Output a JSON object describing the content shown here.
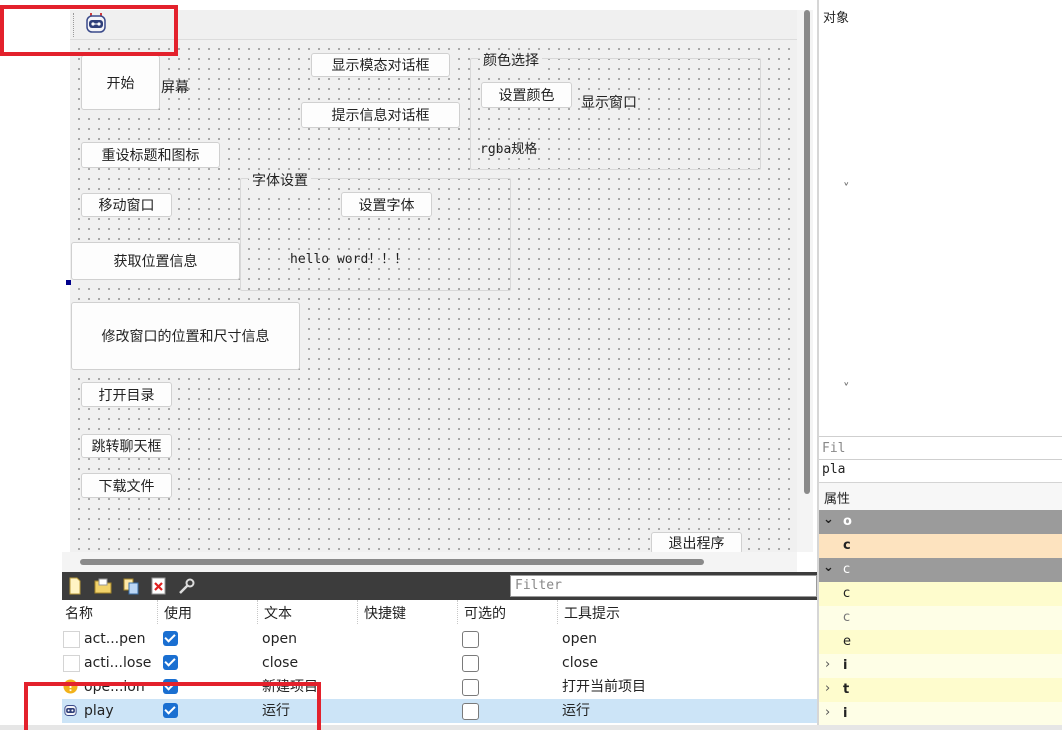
{
  "toolbar": {
    "icon": "robot-icon"
  },
  "form": {
    "start_button": "开始",
    "screen_label": "屏幕",
    "modal_button": "显示模态对话框",
    "tip_button": "提示信息对话框",
    "reset_title_button": "重设标题和图标",
    "move_window_button": "移动窗口",
    "get_position_button": "获取位置信息",
    "modify_window_button": "修改窗口的位置和尺寸信息",
    "open_dir_button": "打开目录",
    "chat_button": "跳转聊天框",
    "download_button": "下载文件",
    "exit_button": "退出程序",
    "color_group": {
      "title": "颜色选择",
      "set_color_button": "设置颜色",
      "show_window_label": "显示窗口",
      "rgba_label": "rgba规格"
    },
    "font_group": {
      "title": "字体设置",
      "set_font_button": "设置字体",
      "hello_label": "hello word！！！"
    }
  },
  "right_panel": {
    "object_header": "对象",
    "filter_placeholder": "Fil",
    "object_name": "pla",
    "property_header": "属性",
    "props": [
      "o",
      "c",
      "e",
      "i",
      "t",
      "i"
    ]
  },
  "action_editor": {
    "filter_placeholder": "Filter",
    "toolbar_icons": [
      "new-action-icon",
      "open-folder-icon",
      "copy-icon",
      "delete-icon",
      "wrench-icon"
    ],
    "columns": [
      "名称",
      "使用",
      "文本",
      "快捷键",
      "可选的",
      "工具提示"
    ],
    "rows": [
      {
        "name": "act...pen",
        "used": true,
        "text": "open",
        "shortcut": "",
        "checkable": false,
        "tooltip": "open",
        "icon": "blank-icon"
      },
      {
        "name": "acti...lose",
        "used": true,
        "text": "close",
        "shortcut": "",
        "checkable": false,
        "tooltip": "close",
        "icon": "blank-icon"
      },
      {
        "name": "ope...ion",
        "used": true,
        "text": "新建项目",
        "shortcut": "",
        "checkable": false,
        "tooltip": "打开当前项目",
        "icon": "warning-icon"
      },
      {
        "name": "play",
        "used": true,
        "text": "运行",
        "shortcut": "",
        "checkable": false,
        "tooltip": "运行",
        "icon": "robot-icon",
        "selected": true
      }
    ]
  },
  "colors": {
    "annotation_red": "#e3212c",
    "selection_blue": "#cce4f7",
    "check_blue": "#1a6fd1",
    "toolbar_dark": "#3c3c3c"
  }
}
